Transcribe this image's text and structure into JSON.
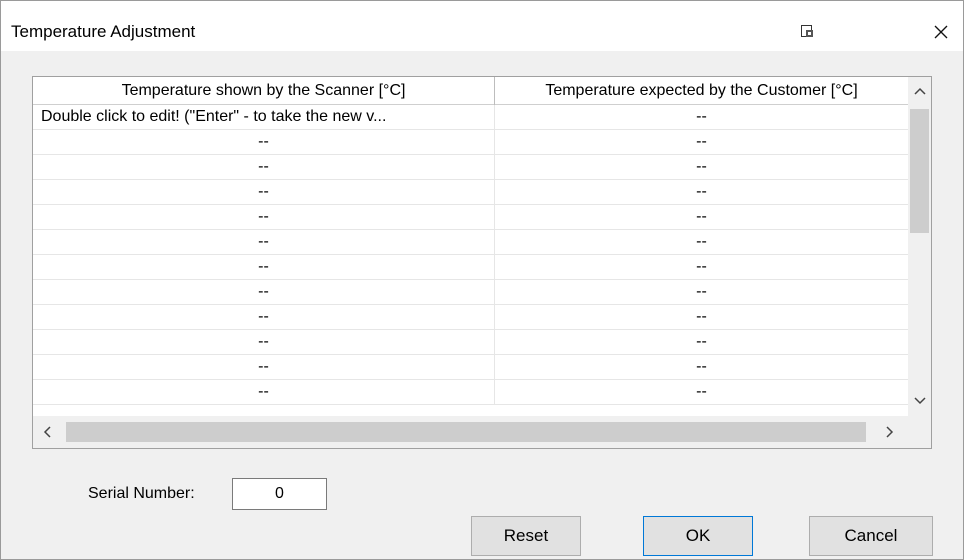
{
  "window": {
    "title": "Temperature Adjustment",
    "icons": {
      "restore": "window-restore-icon",
      "close": "close-icon"
    }
  },
  "grid": {
    "columns": [
      "Temperature shown by the Scanner [°C]",
      "Temperature expected by the Customer [°C]"
    ],
    "rows": [
      [
        "Double click to edit! (\"Enter\" - to take the new v...",
        "--"
      ],
      [
        "--",
        "--"
      ],
      [
        "--",
        "--"
      ],
      [
        "--",
        "--"
      ],
      [
        "--",
        "--"
      ],
      [
        "--",
        "--"
      ],
      [
        "--",
        "--"
      ],
      [
        "--",
        "--"
      ],
      [
        "--",
        "--"
      ],
      [
        "--",
        "--"
      ],
      [
        "--",
        "--"
      ],
      [
        "--",
        "--"
      ]
    ]
  },
  "serial": {
    "label": "Serial Number:",
    "value": "0"
  },
  "buttons": {
    "reset": "Reset",
    "ok": "OK",
    "cancel": "Cancel"
  }
}
